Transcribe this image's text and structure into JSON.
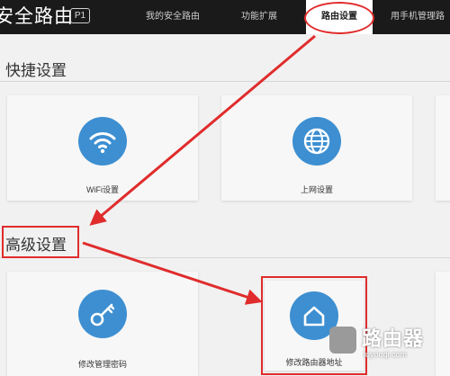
{
  "header": {
    "brand_title": "安全路由",
    "brand_badge": "P1",
    "nav": [
      {
        "label": "我的安全路由"
      },
      {
        "label": "功能扩展"
      },
      {
        "label": "路由设置"
      },
      {
        "label": "用手机管理路"
      }
    ]
  },
  "quick_settings": {
    "title": "快捷设置",
    "cards": [
      {
        "label": "WiFi设置",
        "icon": "wifi-icon"
      },
      {
        "label": "上网设置",
        "icon": "globe-icon"
      },
      {
        "label": "",
        "icon": ""
      }
    ]
  },
  "advanced_settings": {
    "title": "高级设置",
    "cards": [
      {
        "label": "修改管理密码",
        "icon": "key-icon"
      },
      {
        "label": "修改路由器地址",
        "icon": "home-icon"
      },
      {
        "label": "",
        "icon": ""
      }
    ]
  },
  "watermark": {
    "text": "路由器",
    "url": "luyouqi.com"
  },
  "colors": {
    "header_bg": "#1a1a1a",
    "icon_blue": "#3d8fd1",
    "annotation_red": "#e02c2c"
  }
}
